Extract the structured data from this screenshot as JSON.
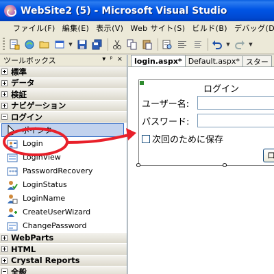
{
  "window": {
    "title": "WebSite2 (5) - Microsoft Visual Studio"
  },
  "menu": [
    "ファイル(F)",
    "編集(E)",
    "表示(V)",
    "Web サイト(S)",
    "ビルド(B)",
    "デバッグ(D)"
  ],
  "toolbar": {
    "icons": [
      "new-project-icon",
      "add-item-icon",
      "open-icon",
      "add-dropdown-icon",
      "save-icon",
      "save-all-icon",
      "cut-icon",
      "copy-icon",
      "paste-icon",
      "find-icon",
      "format-icon",
      "align-icon",
      "undo-icon",
      "redo-icon"
    ]
  },
  "toolbox": {
    "title": "ツールボックス",
    "pin_glyph": "ᵖ",
    "close_glyph": "×",
    "groups_top": [
      {
        "label": "標準"
      },
      {
        "label": "データ"
      },
      {
        "label": "検証"
      },
      {
        "label": "ナビゲーション"
      }
    ],
    "open_group": {
      "label": "ログイン"
    },
    "tools": [
      {
        "label": "ポインタ",
        "icon": "pointer-icon"
      },
      {
        "label": "Login",
        "icon": "login-control-icon"
      },
      {
        "label": "LoginView",
        "icon": "loginview-icon"
      },
      {
        "label": "PasswordRecovery",
        "icon": "passwordrecovery-icon"
      },
      {
        "label": "LoginStatus",
        "icon": "loginstatus-icon"
      },
      {
        "label": "LoginName",
        "icon": "loginname-icon"
      },
      {
        "label": "CreateUserWizard",
        "icon": "createuserwizard-icon"
      },
      {
        "label": "ChangePassword",
        "icon": "changepassword-icon"
      }
    ],
    "groups_bottom": [
      {
        "label": "WebParts"
      },
      {
        "label": "HTML"
      },
      {
        "label": "Crystal Reports"
      },
      {
        "label": "全般"
      }
    ]
  },
  "editor": {
    "tabs": [
      "login.aspx*",
      "Default.aspx*",
      "スター"
    ],
    "login_control": {
      "title": "ログイン",
      "username_label": "ユーザー名:",
      "password_label": "パスワード:",
      "remember_label": "次回のために保存",
      "button_label": "ロ"
    }
  },
  "colors": {
    "titlebar": "#0055e5",
    "annotation_red": "#e8202a",
    "selection": "#316ac5"
  }
}
